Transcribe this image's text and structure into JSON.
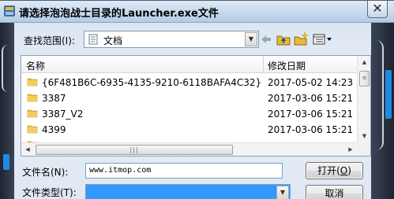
{
  "window": {
    "title": "请选择泡泡战士目录的Launcher.exe文件",
    "close_glyph": "✕"
  },
  "lookin": {
    "label": "查找范围(I):",
    "value": "文档"
  },
  "list": {
    "columns": {
      "name": "名称",
      "date": "修改日期"
    },
    "rows": [
      {
        "name": "{6F481B6C-6935-4135-9210-6118BAFA4C32}",
        "date": "2017-05-02 14:23"
      },
      {
        "name": "3387",
        "date": "2017-03-06 15:21"
      },
      {
        "name": "3387_V2",
        "date": "2017-03-06 15:21"
      },
      {
        "name": "4399",
        "date": "2017-03-06 15:21"
      }
    ]
  },
  "filename": {
    "label": "文件名(N):",
    "value": "www.itmop.com"
  },
  "filetype": {
    "label": "文件类型(T):",
    "value": ""
  },
  "buttons": {
    "open_label": "打开(",
    "open_mnemonic": "O",
    "open_end": ")",
    "cancel_label": "取消"
  },
  "colors": {
    "selection": "#3399ff",
    "folder": "#e8b93a",
    "accent_blue": "#1e8be0"
  },
  "icons": [
    "app-icon",
    "folder-icon",
    "back-arrow-icon",
    "up-folder-icon",
    "new-folder-icon",
    "view-menu-icon"
  ]
}
